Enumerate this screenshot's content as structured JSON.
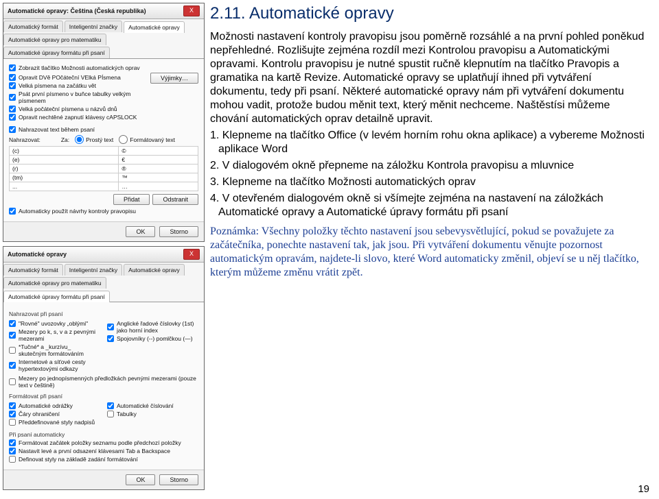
{
  "heading": "2.11. Automatické opravy",
  "p1": "Možnosti nastavení kontroly pravopisu jsou poměrně rozsáhlé a na první pohled poněkud nepřehledné. Rozlišujte zejména rozdíl mezi Kontrolou pravopisu a Automatickými opravami. Kontrolu pravopisu je nutné spustit ručně klepnutím na tlačítko Pravopis a gramatika na kartě Revize. Automatické opravy se uplatňují ihned při vytváření dokumentu, tedy při psaní. Některé automatické opravy nám při vytváření dokumentu mohou vadit, protože budou měnit text, který měnit nechceme. Naštěstísi můžeme chování automatických oprav detailně upravit.",
  "s1": "  1. Klepneme na tlačítko Office (v levém horním rohu okna aplikace) a vybereme Možnosti aplikace Word",
  "s2": "  2. V dialogovém okně přepneme na záložku Kontrola pravopisu a mluvnice",
  "s3": "  3. Klepneme na tlačítko Možnosti automatických oprav",
  "s4": "  4. V otevřeném dialogovém okně si všímejte zejména na nastavení na záložkách Automatické opravy a Automatické úpravy formátu při psaní",
  "note": "Poznámka: Všechny položky těchto nastavení jsou sebevysvětlující, pokud se považujete za začátečníka, ponechte nastavení tak, jak jsou. Při vytváření dokumentu věnujte pozornost automatickým opravám, najdete-li slovo, které Word automaticky změnil, objeví se u něj tlačítko, kterým můžeme změnu vrátit zpět.",
  "page": "19",
  "dlg1": {
    "title": "Automatické opravy: Čeština (Česká republika)",
    "close": "X",
    "tabs": [
      "Automatický formát",
      "Inteligentní značky",
      "Automatické opravy",
      "Automatické opravy pro matematiku",
      "Automatické úpravy formátu při psaní"
    ],
    "opts": [
      "Zobrazit tlačítko Možnosti automatických oprav",
      "Opravit DVě POčáteční VElká PÍsmena",
      "Velká písmena na začátku vět",
      "Psát první písmeno v buňce tabulky velkým písmenem",
      "Velká počáteční písmena u názvů dnů",
      "Opravit nechtěné zapnutí klávesy cAPSLOCK"
    ],
    "replaceChk": "Nahrazovat text během psaní",
    "replaceLabel": "Nahrazovat:",
    "za": "Za:",
    "rprosty": "Prostý text",
    "rform": "Formátovaný text",
    "pairs": [
      [
        "(c)",
        "©"
      ],
      [
        "(e)",
        "€"
      ],
      [
        "(r)",
        "®"
      ],
      [
        "(tm)",
        "™"
      ],
      [
        "...",
        "…"
      ]
    ],
    "addBtn": "Přidat",
    "delBtn": "Odstranit",
    "autoSugg": "Automaticky použít návrhy kontroly pravopisu",
    "vyjimky": "Výjimky…",
    "ok": "OK",
    "storno": "Storno"
  },
  "dlg2": {
    "title": "Automatické opravy",
    "close": "X",
    "tabs": [
      "Automatický formát",
      "Inteligentní značky",
      "Automatické opravy",
      "Automatické opravy pro matematiku",
      "Automatické úpravy formátu při psaní"
    ],
    "grp1": "Nahrazovat při psaní",
    "left1": [
      "\"Rovné\" uvozovky „oblými\"",
      "Mezery po k, s, v a z pevnými mezerami",
      "*Tučné* a _kurzívu_ skutečným formátováním",
      "Internetové a síťové cesty hypertextovými odkazy"
    ],
    "right1": [
      "Anglické řadové číslovky (1st) jako horní index",
      "Spojovníky (--) pomlčkou (—)"
    ],
    "single": "Mezery po jednopísmenných předložkách pevnými mezerami (pouze text v češtině)",
    "grp2": "Formátovat při psaní",
    "left2": [
      "Automatické odrážky",
      "Čáry ohraničení",
      "Předdefinované styly nadpisů"
    ],
    "right2": [
      "Automatické číslování",
      "Tabulky"
    ],
    "grp3": "Při psaní automaticky",
    "list3": [
      "Formátovat začátek položky seznamu podle předchozí položky",
      "Nastavit levé a první odsazení klávesami Tab a Backspace",
      "Definovat styly na základě zadání formátování"
    ],
    "ok": "OK",
    "storno": "Storno"
  }
}
